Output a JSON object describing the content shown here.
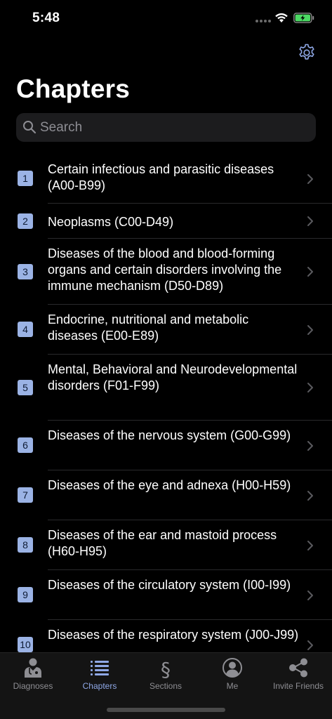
{
  "status": {
    "time": "5:48"
  },
  "header": {
    "title": "Chapters"
  },
  "search": {
    "placeholder": "Search",
    "value": ""
  },
  "chapters": [
    {
      "num": "1",
      "title": "Certain infectious and parasitic diseases (A00-B99)"
    },
    {
      "num": "2",
      "title": "Neoplasms (C00-D49)"
    },
    {
      "num": "3",
      "title": "Diseases of the blood and blood-forming organs and certain disorders involving the immune mechanism (D50-D89)"
    },
    {
      "num": "4",
      "title": "Endocrine, nutritional and metabolic diseases (E00-E89)"
    },
    {
      "num": "5",
      "title": "Mental, Behavioral and Neurodevelopmental disorders (F01-F99)"
    },
    {
      "num": "6",
      "title": "Diseases of the nervous system (G00-G99)"
    },
    {
      "num": "7",
      "title": "Diseases of the eye and adnexa (H00-H59)"
    },
    {
      "num": "8",
      "title": "Diseases of the ear and mastoid process (H60-H95)"
    },
    {
      "num": "9",
      "title": "Diseases of the circulatory system (I00-I99)"
    },
    {
      "num": "10",
      "title": "Diseases of the respiratory system (J00-J99)"
    }
  ],
  "tabs": [
    {
      "label": "Diagnoses",
      "icon": "doctor-icon",
      "active": false
    },
    {
      "label": "Chapters",
      "icon": "list-icon",
      "active": true
    },
    {
      "label": "Sections",
      "icon": "section-icon",
      "active": false
    },
    {
      "label": "Me",
      "icon": "person-icon",
      "active": false
    },
    {
      "label": "Invite Friends",
      "icon": "share-icon",
      "active": false
    }
  ],
  "colors": {
    "accent": "#8fa8e6",
    "badge": "#9bb3e5",
    "background": "#000000",
    "battery": "#4cd964"
  }
}
